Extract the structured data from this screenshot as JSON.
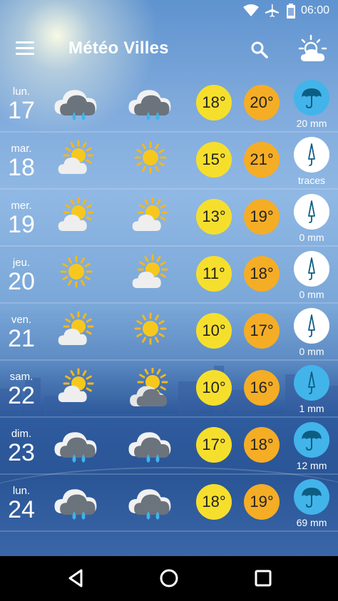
{
  "status_bar": {
    "time": "06:00",
    "icons": [
      "wifi-icon",
      "airplane-mode-icon",
      "battery-icon"
    ]
  },
  "app_bar": {
    "title": "Météo Villes",
    "icons": [
      "menu-icon",
      "search-icon",
      "sun-cloud-icon"
    ]
  },
  "forecast": [
    {
      "day": "lun.",
      "date": "17",
      "icon_morning": "rain-cloud-icon",
      "icon_afternoon": "rain-cloud-icon",
      "temp_min": "18°",
      "temp_max": "20°",
      "rain_icon": "umbrella-icon",
      "rain": "20 mm"
    },
    {
      "day": "mar.",
      "date": "18",
      "icon_morning": "sun-cloud-icon",
      "icon_afternoon": "sun-icon",
      "temp_min": "15°",
      "temp_max": "21°",
      "rain_icon": "closed-umbrella-icon",
      "rain": "traces"
    },
    {
      "day": "mer.",
      "date": "19",
      "icon_morning": "sun-cloud-icon",
      "icon_afternoon": "sun-cloud-icon",
      "temp_min": "13°",
      "temp_max": "19°",
      "rain_icon": "closed-umbrella-icon",
      "rain": "0 mm"
    },
    {
      "day": "jeu.",
      "date": "20",
      "icon_morning": "sun-icon",
      "icon_afternoon": "sun-cloud-icon",
      "temp_min": "11°",
      "temp_max": "18°",
      "rain_icon": "closed-umbrella-icon",
      "rain": "0 mm"
    },
    {
      "day": "ven.",
      "date": "21",
      "icon_morning": "sun-cloud-icon",
      "icon_afternoon": "sun-icon",
      "temp_min": "10°",
      "temp_max": "17°",
      "rain_icon": "closed-umbrella-icon",
      "rain": "0 mm"
    },
    {
      "day": "sam.",
      "date": "22",
      "icon_morning": "sun-cloud-icon",
      "icon_afternoon": "sun-dark-cloud-icon",
      "temp_min": "10°",
      "temp_max": "16°",
      "rain_icon": "closed-umbrella-icon",
      "rain": "1 mm"
    },
    {
      "day": "dim.",
      "date": "23",
      "icon_morning": "rain-cloud-icon",
      "icon_afternoon": "rain-cloud-icon",
      "temp_min": "17°",
      "temp_max": "18°",
      "rain_icon": "umbrella-icon",
      "rain": "12 mm"
    },
    {
      "day": "lun.",
      "date": "24",
      "icon_morning": "rain-cloud-icon",
      "icon_afternoon": "rain-cloud-icon",
      "temp_min": "18°",
      "temp_max": "19°",
      "rain_icon": "umbrella-icon",
      "rain": "69 mm"
    }
  ],
  "nav_bar": {
    "icons": [
      "back-icon",
      "home-icon",
      "recents-icon"
    ]
  },
  "colors": {
    "temp_min": "#f6df2c",
    "temp_max": "#f5ad25",
    "rain_heavy": "#42b4ea",
    "rain_light": "#ffffff"
  }
}
